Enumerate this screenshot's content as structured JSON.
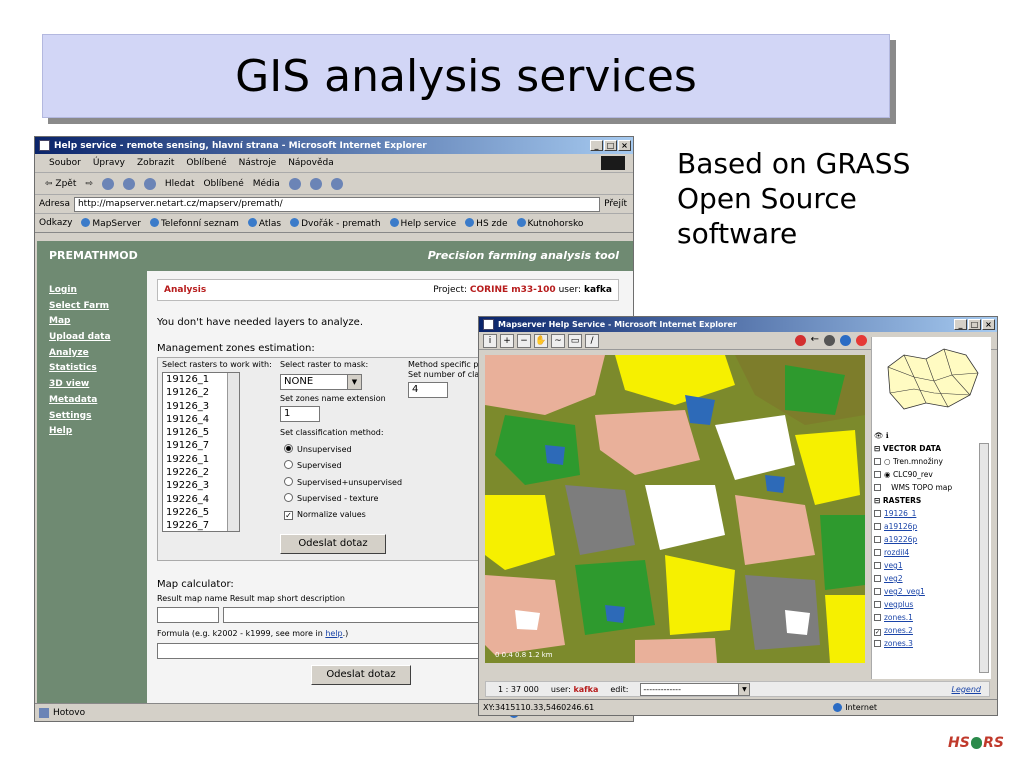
{
  "slide": {
    "title": "GIS analysis services",
    "side_lines": [
      "Based on GRASS",
      "Open Source",
      "software"
    ],
    "logo_left": "HS",
    "logo_right": "RS"
  },
  "ie_window": {
    "title": "Help service - remote sensing, hlavní strana - Microsoft Internet Explorer",
    "menu": [
      "Soubor",
      "Úpravy",
      "Zobrazit",
      "Oblíbené",
      "Nástroje",
      "Nápověda"
    ],
    "toolbar": [
      "⇦ Zpět",
      "Hledat",
      "Oblíbené",
      "Média"
    ],
    "address_label": "Adresa",
    "address_url": "http://mapserver.netart.cz/mapserv/premath/",
    "go_label": "Přejít",
    "links_label": "Odkazy",
    "links": [
      "MapServer",
      "Telefonní seznam",
      "Atlas",
      "Dvořák - premath",
      "Help service",
      "HS zde",
      "Kutnohorsko"
    ],
    "status_text": "Hotovo",
    "status_zone": "Inter"
  },
  "app": {
    "brand": "PREMATHMOD",
    "tagline": "Precision farming analysis tool",
    "nav": [
      "Login",
      "Select Farm",
      "Map",
      "Upload data",
      "Analyze",
      "Statistics",
      "3D view",
      "Metadata",
      "Settings",
      "Help"
    ],
    "analysis_title": "Analysis",
    "project_label": "Project:",
    "project_name": "CORINE m33-100",
    "user_label": "user:",
    "user_name": "kafka",
    "message": "You don't have needed layers to analyze.",
    "mz_label": "Management zones estimation:",
    "select_rasters_label": "Select rasters to work with:",
    "rasters": [
      "19126_1",
      "19126_2",
      "19126_3",
      "19126_4",
      "19126_5",
      "19126_7",
      "19226_1",
      "19226_2",
      "19226_3",
      "19226_4",
      "19226_5",
      "19226_7"
    ],
    "mask_label": "Select raster to mask:",
    "mask_value": "NONE",
    "ext_label": "Set zones name extension",
    "ext_value": "1",
    "method_params_label": "Method specific parc",
    "num_classes_label": "Set number of class",
    "num_classes_value": "4",
    "class_method_label": "Set classification method:",
    "methods": [
      "Unsupervised",
      "Supervised",
      "Supervised+unsupervised",
      "Supervised - texture"
    ],
    "normalize_label": "Normalize values",
    "submit_label": "Odeslat dotaz",
    "calc_label": "Map calculator:",
    "result_name_label": "Result map name",
    "result_desc_label": "Result map short description",
    "formula_label": "Formula (e.g. k2002 - k1999, see more in ",
    "formula_link": "help",
    "formula_end": ".)",
    "submit2_label": "Odeslat dotaz"
  },
  "mapserver": {
    "title": "Mapserver Help Service - Microsoft Internet Explorer",
    "scale_ticks": "0    0.4    0.8    1.2 km",
    "scale_label": "1 : 37 000",
    "user_label": "user:",
    "user_name": "kafka",
    "edit_label": "edit:",
    "edit_value": "-------------",
    "legend_link": "Legend",
    "coords": "XY:3415110.33,5460246.61",
    "zone": "Internet",
    "vector_header": "VECTOR DATA",
    "vectors": [
      "Tren.množiny",
      "CLC90_rev",
      "WMS TOPO map"
    ],
    "raster_header": "RASTERS",
    "rasters": [
      "19126_1",
      "a19126p",
      "a19226p",
      "rozdil4",
      "veg1",
      "veg2",
      "veg2_veg1",
      "vegplus",
      "zones.1",
      "zones.2",
      "zones.3"
    ]
  },
  "colors": {
    "slide_title_bg": "#d2d6f6",
    "nav_green": "#6f8a72",
    "accent_red": "#b71c1c",
    "titlebar_blue": "#0a246a"
  }
}
